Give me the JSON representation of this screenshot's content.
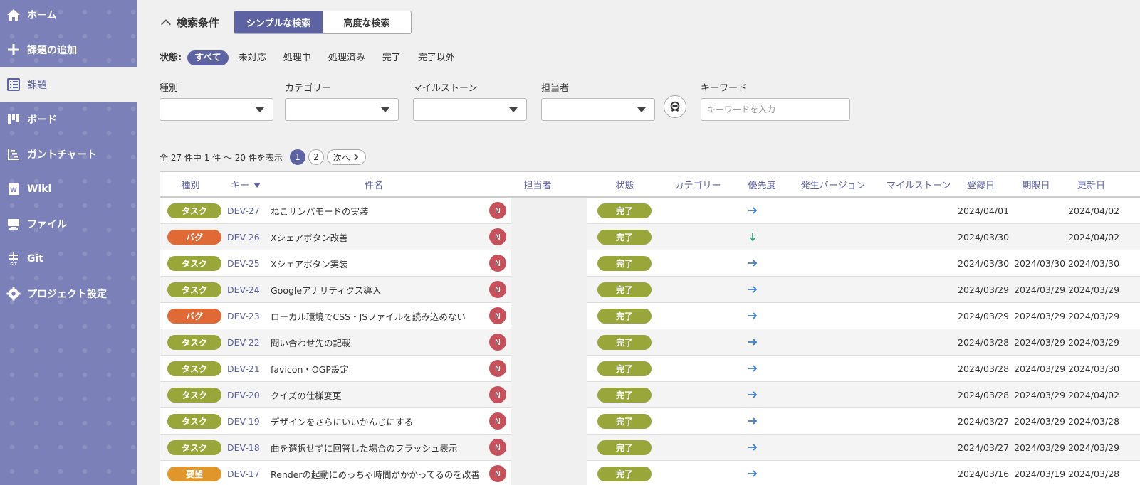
{
  "nav": [
    {
      "id": "home",
      "label": "ホーム",
      "icon": "home-icon"
    },
    {
      "id": "add",
      "label": "課題の追加",
      "icon": "plus-icon"
    },
    {
      "id": "issues",
      "label": "課題",
      "icon": "list-icon",
      "active": true
    },
    {
      "id": "board",
      "label": "ボード",
      "icon": "board-icon"
    },
    {
      "id": "gantt",
      "label": "ガントチャート",
      "icon": "gantt-icon"
    },
    {
      "id": "wiki",
      "label": "Wiki",
      "icon": "wiki-icon"
    },
    {
      "id": "files",
      "label": "ファイル",
      "icon": "files-icon"
    },
    {
      "id": "git",
      "label": "Git",
      "icon": "git-icon"
    },
    {
      "id": "settings",
      "label": "プロジェクト設定",
      "icon": "gear-icon"
    }
  ],
  "search": {
    "title": "検索条件",
    "mode_simple": "シンプルな検索",
    "mode_advanced": "高度な検索",
    "status_label": "状態:",
    "status_options": [
      "すべて",
      "未対応",
      "処理中",
      "処理済み",
      "完了",
      "完了以外"
    ],
    "status_selected": "すべて",
    "filters": {
      "type": "種別",
      "category": "カテゴリー",
      "milestone": "マイルストーン",
      "assignee": "担当者",
      "keyword": "キーワード",
      "keyword_placeholder": "キーワードを入力"
    }
  },
  "pager": {
    "summary": "全 27 件中 1 件 〜 20 件を表示",
    "pages": [
      "1",
      "2"
    ],
    "current": "1",
    "next": "次へ"
  },
  "columns": {
    "type": "種別",
    "key": "キー",
    "summary": "件名",
    "assignee": "担当者",
    "status": "状態",
    "category": "カテゴリー",
    "priority": "優先度",
    "version": "発生バージョン",
    "milestone": "マイルストーン",
    "created": "登録日",
    "due": "期限日",
    "updated": "更新日"
  },
  "colors": {
    "accent": "#5d62a3",
    "task": "#99a63a",
    "bug": "#e06a36",
    "request": "#e0962a",
    "done": "#99a63a",
    "avatar": "#c7515a"
  },
  "issues": [
    {
      "type": "タスク",
      "type_color": "#99a63a",
      "key": "DEV-27",
      "summary": "ねこサンバモードの実装",
      "avatar": "N",
      "status": "完了",
      "priority": "normal",
      "created": "2024/04/01",
      "due": "",
      "updated": "2024/04/02"
    },
    {
      "type": "バグ",
      "type_color": "#e06a36",
      "key": "DEV-26",
      "summary": "Xシェアボタン改善",
      "avatar": "N",
      "status": "完了",
      "priority": "low",
      "created": "2024/03/30",
      "due": "",
      "updated": "2024/04/02"
    },
    {
      "type": "タスク",
      "type_color": "#99a63a",
      "key": "DEV-25",
      "summary": "Xシェアボタン実装",
      "avatar": "N",
      "status": "完了",
      "priority": "normal",
      "created": "2024/03/30",
      "due": "2024/03/30",
      "updated": "2024/03/30"
    },
    {
      "type": "タスク",
      "type_color": "#99a63a",
      "key": "DEV-24",
      "summary": "Googleアナリティクス導入",
      "avatar": "N",
      "status": "完了",
      "priority": "normal",
      "created": "2024/03/29",
      "due": "2024/03/29",
      "updated": "2024/03/29"
    },
    {
      "type": "バグ",
      "type_color": "#e06a36",
      "key": "DEV-23",
      "summary": "ローカル環境でCSS・JSファイルを読み込めない",
      "avatar": "N",
      "status": "完了",
      "priority": "normal",
      "created": "2024/03/29",
      "due": "2024/03/29",
      "updated": "2024/03/29"
    },
    {
      "type": "タスク",
      "type_color": "#99a63a",
      "key": "DEV-22",
      "summary": "問い合わせ先の記載",
      "avatar": "N",
      "status": "完了",
      "priority": "normal",
      "created": "2024/03/28",
      "due": "2024/03/29",
      "updated": "2024/03/29"
    },
    {
      "type": "タスク",
      "type_color": "#99a63a",
      "key": "DEV-21",
      "summary": "favicon・OGP設定",
      "avatar": "N",
      "status": "完了",
      "priority": "normal",
      "created": "2024/03/28",
      "due": "2024/03/29",
      "updated": "2024/03/30"
    },
    {
      "type": "タスク",
      "type_color": "#99a63a",
      "key": "DEV-20",
      "summary": "クイズの仕様変更",
      "avatar": "N",
      "status": "完了",
      "priority": "normal",
      "created": "2024/03/28",
      "due": "2024/03/29",
      "updated": "2024/04/02"
    },
    {
      "type": "タスク",
      "type_color": "#99a63a",
      "key": "DEV-19",
      "summary": "デザインをさらにいいかんじにする",
      "avatar": "N",
      "status": "完了",
      "priority": "normal",
      "created": "2024/03/27",
      "due": "2024/03/29",
      "updated": "2024/03/28"
    },
    {
      "type": "タスク",
      "type_color": "#99a63a",
      "key": "DEV-18",
      "summary": "曲を選択せずに回答した場合のフラッシュ表示",
      "avatar": "N",
      "status": "完了",
      "priority": "normal",
      "created": "2024/03/27",
      "due": "2024/03/29",
      "updated": "2024/03/29"
    },
    {
      "type": "要望",
      "type_color": "#e0962a",
      "key": "DEV-17",
      "summary": "Renderの起動にめっちゃ時間がかかってるのを改善",
      "avatar": "N",
      "status": "完了",
      "priority": "normal",
      "created": "2024/03/16",
      "due": "2024/03/19",
      "updated": "2024/03/28"
    }
  ]
}
